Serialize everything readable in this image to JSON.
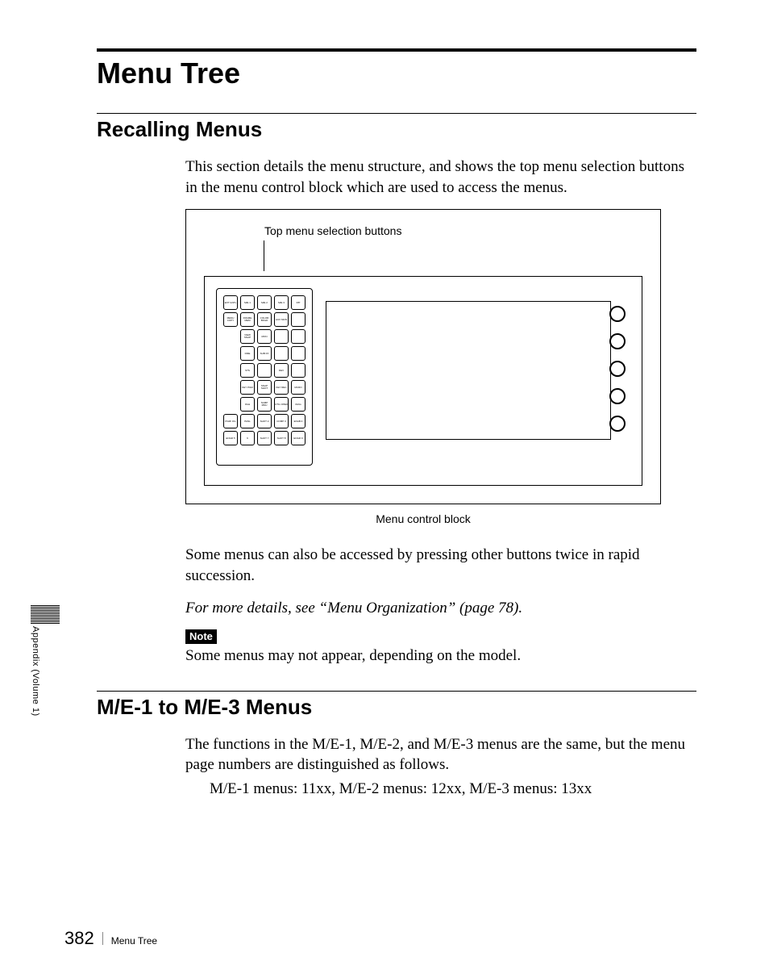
{
  "title": "Menu Tree",
  "section1": {
    "heading": "Recalling Menus",
    "intro": "This section details the menu structure, and shows the top menu selection buttons in the menu control block which are used to access the menus.",
    "figure": {
      "top_label": "Top menu selection buttons",
      "caption": "Menu control block",
      "buttons_row1": [
        "EXT GNTL",
        "M/E 1",
        "M/E 2",
        "M/E 3",
        "P/P"
      ],
      "buttons_row2": [
        "MENU COPY",
        "FRAME MEM",
        "COLOR BKGD",
        "AUX MON"
      ],
      "buttons_row3": [
        "VIEW SNAP",
        "MON"
      ],
      "buttons_row4": [
        "DME",
        "SUB FX"
      ],
      "buttons_row5": [
        "STS",
        "DEV"
      ],
      "buttons_row6": [
        "KEY PGM",
        "SNAP SHOT",
        "KEY REC",
        "MCRO"
      ],
      "buttons_row7": [
        "FILE",
        "SAMP MNU",
        "UTIL OPER",
        "DIAG"
      ],
      "buttons_row8": [
        "PGM/ O/L",
        "PANL",
        "SHOT 2",
        "COMP 3",
        "ENAB 4"
      ],
      "buttons_row9": [
        "ENGR 5",
        "6",
        "SHOT 7",
        "SHOT 8",
        "ENGR 9"
      ]
    },
    "para2": "Some menus can also be accessed by pressing other buttons twice in rapid succession.",
    "para3": "For more details, see “Menu Organization” (page 78).",
    "note_label": "Note",
    "note_text": "Some menus may not appear, depending on the model."
  },
  "section2": {
    "heading": "M/E-1 to M/E-3 Menus",
    "para1": "The functions in the M/E-1, M/E-2, and M/E-3 menus are the same, but the menu page numbers are distinguished as follows.",
    "para2": "M/E-1 menus: 11xx, M/E-2 menus: 12xx, M/E-3 menus: 13xx"
  },
  "side_text": "Appendix (Volume 1)",
  "footer": {
    "page_number": "382",
    "section_title": "Menu Tree"
  }
}
